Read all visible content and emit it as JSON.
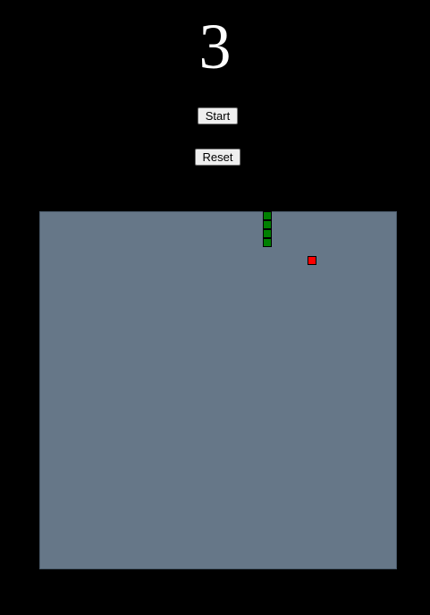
{
  "score": "3",
  "controls": {
    "start_label": "Start",
    "reset_label": "Reset"
  },
  "board": {
    "grid_size": 40,
    "background_color": "#667788",
    "snake_color": "#008000",
    "food_color": "#ff0000",
    "snake": [
      [
        25,
        0
      ],
      [
        25,
        1
      ],
      [
        25,
        2
      ],
      [
        25,
        3
      ]
    ],
    "food": [
      30,
      5
    ]
  }
}
